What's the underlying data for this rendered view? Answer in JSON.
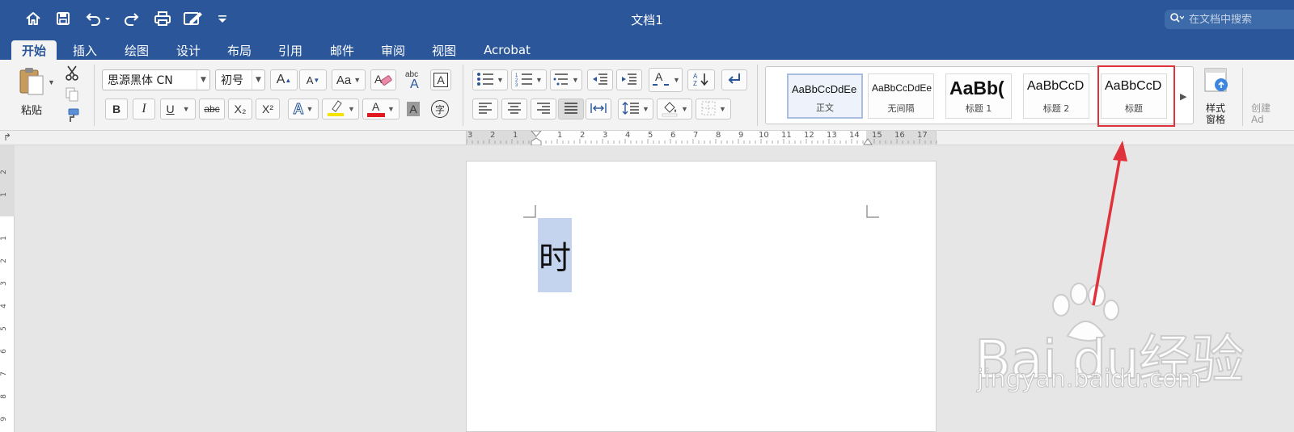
{
  "window": {
    "title": "文档1",
    "search_placeholder": "在文档中搜索"
  },
  "tabs": [
    {
      "label": "开始",
      "active": true
    },
    {
      "label": "插入"
    },
    {
      "label": "绘图"
    },
    {
      "label": "设计"
    },
    {
      "label": "布局"
    },
    {
      "label": "引用"
    },
    {
      "label": "邮件"
    },
    {
      "label": "审阅"
    },
    {
      "label": "视图"
    },
    {
      "label": "Acrobat"
    }
  ],
  "clipboard": {
    "paste_label": "粘贴"
  },
  "font": {
    "name": "思源黑体 CN",
    "size": "初号",
    "bold": "B",
    "italic": "I",
    "underline": "U",
    "strike": "abc",
    "subscript": "X₂",
    "superscript": "X²",
    "char_border": "A",
    "phonetic": "字",
    "grow": "A",
    "shrink": "A",
    "change_case": "Aa",
    "font_color": "A",
    "shading": "A",
    "abc": "abc",
    "highlight_color": "#f5e400",
    "font_color_bar": "#e0191f"
  },
  "styles": [
    {
      "sample": "AaBbCcDdEe",
      "name": "正文",
      "selected": true
    },
    {
      "sample": "AaBbCcDdEe",
      "name": "无间隔"
    },
    {
      "sample": "AaBb(",
      "name": "标题 1"
    },
    {
      "sample": "AaBbCcD",
      "name": "标题 2"
    },
    {
      "sample": "AaBbCcD",
      "name": "标题"
    }
  ],
  "style_pane": {
    "label_line1": "样式",
    "label_line2": "窗格"
  },
  "cut_off": {
    "line1": "创建",
    "line2": "Ad"
  },
  "ruler": {
    "h_numbers": [
      "3",
      "2",
      "1",
      "1",
      "2",
      "3",
      "4",
      "5",
      "6",
      "7",
      "8",
      "9",
      "10",
      "11",
      "12",
      "13",
      "14",
      "15",
      "16",
      "17"
    ],
    "v_numbers": [
      "2",
      "1",
      "1",
      "2",
      "3",
      "4",
      "5",
      "6",
      "7",
      "8",
      "9"
    ]
  },
  "document": {
    "selected_text": "时"
  },
  "watermark": {
    "logo": "Bai  du经验",
    "url": "jingyan.baidu.com"
  },
  "colors": {
    "accent": "#2b579a",
    "annotation": "#e0323a"
  }
}
